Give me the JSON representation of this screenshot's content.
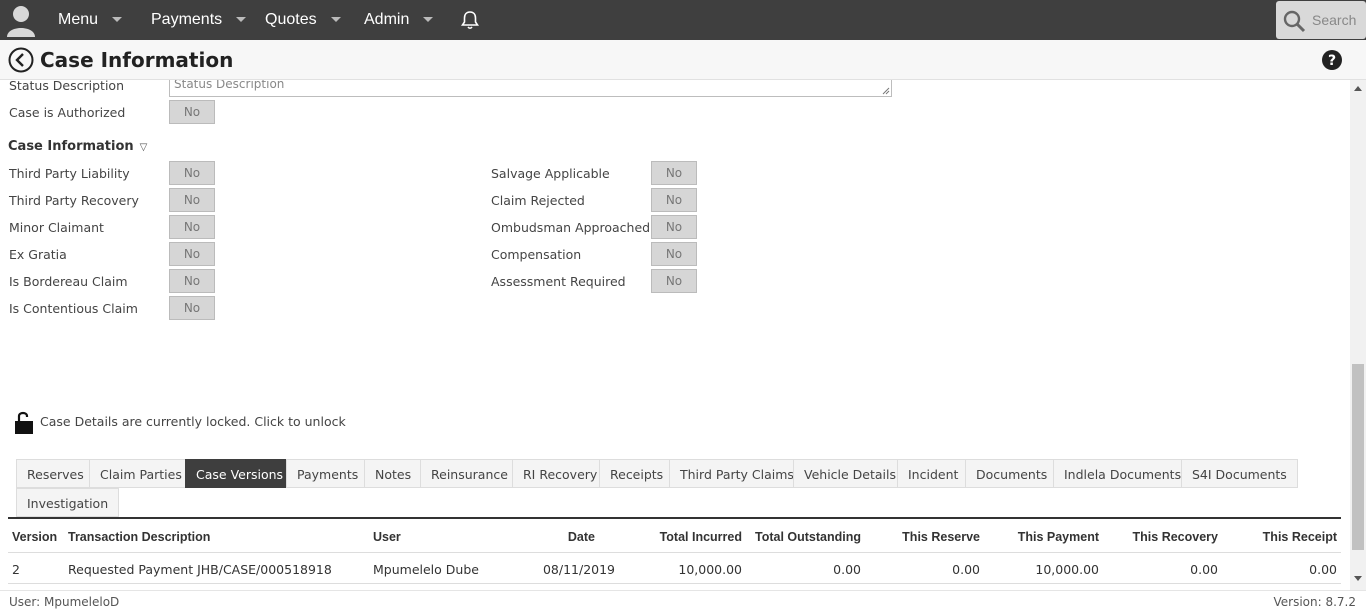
{
  "nav": {
    "menu": "Menu",
    "payments": "Payments",
    "quotes": "Quotes",
    "admin": "Admin",
    "search_placeholder": "Search"
  },
  "header": {
    "title": "Case Information"
  },
  "status": {
    "description_label": "Status Description",
    "description_placeholder": "Status Description",
    "authorized_label": "Case is Authorized",
    "authorized_value": "No"
  },
  "case_info": {
    "title": "Case Information",
    "left": [
      {
        "label": "Third Party Liability",
        "value": "No"
      },
      {
        "label": "Third Party Recovery",
        "value": "No"
      },
      {
        "label": "Minor Claimant",
        "value": "No"
      },
      {
        "label": "Ex Gratia",
        "value": "No"
      },
      {
        "label": "Is Bordereau Claim",
        "value": "No"
      },
      {
        "label": "Is Contentious Claim",
        "value": "No"
      }
    ],
    "right": [
      {
        "label": "Salvage Applicable",
        "value": "No"
      },
      {
        "label": "Claim Rejected",
        "value": "No"
      },
      {
        "label": "Ombudsman Approached",
        "value": "No"
      },
      {
        "label": "Compensation",
        "value": "No"
      },
      {
        "label": "Assessment Required",
        "value": "No"
      }
    ]
  },
  "lock": {
    "text": "Case Details are currently locked. Click to unlock"
  },
  "tabs": [
    "Reserves",
    "Claim Parties",
    "Case Versions",
    "Payments",
    "Notes",
    "Reinsurance",
    "RI Recovery",
    "Receipts",
    "Third Party Claims",
    "Vehicle Details",
    "Incident",
    "Documents",
    "Indlela Documents",
    "S4I Documents",
    "Investigation"
  ],
  "active_tab": "Case Versions",
  "table": {
    "headers": [
      "Version",
      "Transaction Description",
      "User",
      "Date",
      "Total Incurred",
      "Total Outstanding",
      "This Reserve",
      "This Payment",
      "This Recovery",
      "This Receipt"
    ],
    "rows": [
      [
        "2",
        "Requested Payment JHB/CASE/000518918",
        "Mpumelelo Dube",
        "08/11/2019",
        "10,000.00",
        "0.00",
        "0.00",
        "10,000.00",
        "0.00",
        "0.00"
      ]
    ]
  },
  "footer": {
    "user": "User: MpumeleloD",
    "version": "Version: 8.7.2"
  }
}
